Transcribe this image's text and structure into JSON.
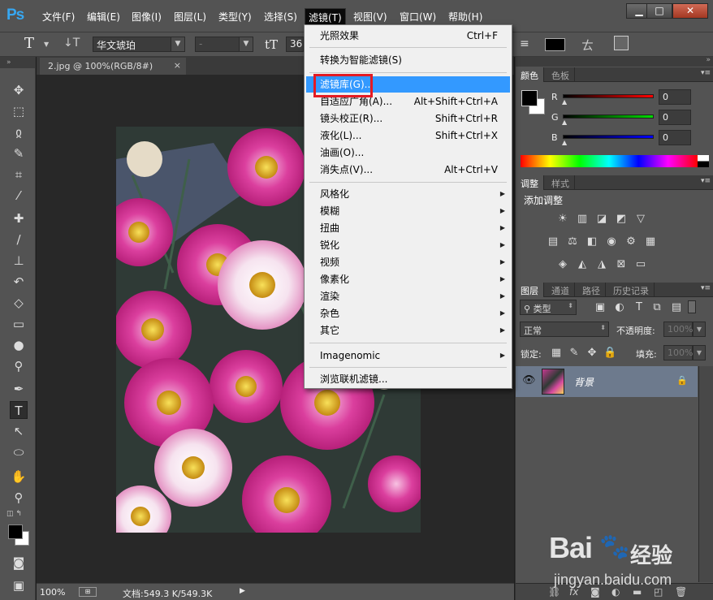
{
  "app": {
    "logo": "Ps"
  },
  "menubar": {
    "items": [
      "文件(F)",
      "编辑(E)",
      "图像(I)",
      "图层(L)",
      "类型(Y)",
      "选择(S)",
      "滤镜(T)",
      "视图(V)",
      "窗口(W)",
      "帮助(H)"
    ],
    "active_index": 6
  },
  "window_controls": {
    "minimize": "▁",
    "maximize": "□",
    "close": "✕"
  },
  "options": {
    "font_family": "华文琥珀",
    "font_style": "-",
    "font_size_partial": "36",
    "text_color": "#000000"
  },
  "document": {
    "tab_title": "2.jpg @ 100%(RGB/8#)",
    "tab_close": "×"
  },
  "status": {
    "zoom": "100%",
    "doc_info": "文档:549.3 K/549.3K"
  },
  "filter_menu": {
    "groups": [
      [
        {
          "label": "光照效果",
          "shortcut": "Ctrl+F"
        }
      ],
      [
        {
          "label": "转换为智能滤镜(S)",
          "shortcut": ""
        }
      ],
      [
        {
          "label": "滤镜库(G)...",
          "shortcut": "",
          "highlighted": true
        },
        {
          "label": "自适应广角(A)...",
          "shortcut": "Alt+Shift+Ctrl+A"
        },
        {
          "label": "镜头校正(R)...",
          "shortcut": "Shift+Ctrl+R"
        },
        {
          "label": "液化(L)...",
          "shortcut": "Shift+Ctrl+X"
        },
        {
          "label": "油画(O)...",
          "shortcut": ""
        },
        {
          "label": "消失点(V)...",
          "shortcut": "Alt+Ctrl+V"
        }
      ],
      [
        {
          "label": "风格化",
          "submenu": true
        },
        {
          "label": "模糊",
          "submenu": true
        },
        {
          "label": "扭曲",
          "submenu": true
        },
        {
          "label": "锐化",
          "submenu": true
        },
        {
          "label": "视频",
          "submenu": true
        },
        {
          "label": "像素化",
          "submenu": true
        },
        {
          "label": "渲染",
          "submenu": true
        },
        {
          "label": "杂色",
          "submenu": true
        },
        {
          "label": "其它",
          "submenu": true
        }
      ],
      [
        {
          "label": "Imagenomic",
          "submenu": true
        }
      ],
      [
        {
          "label": "浏览联机滤镜...",
          "shortcut": ""
        }
      ]
    ]
  },
  "color_panel": {
    "tabs": [
      "颜色",
      "色板"
    ],
    "channels": [
      {
        "label": "R",
        "value": "0",
        "color": "#ff0000"
      },
      {
        "label": "G",
        "value": "0",
        "color": "#00d000"
      },
      {
        "label": "B",
        "value": "0",
        "color": "#0000ff"
      }
    ],
    "foreground": "#000000",
    "background": "#ffffff"
  },
  "adjust_panel": {
    "tabs": [
      "调整",
      "样式"
    ],
    "title": "添加调整"
  },
  "layers_panel": {
    "tabs": [
      "图层",
      "通道",
      "路径",
      "历史记录"
    ],
    "filter_kind": "类型",
    "blend_mode": "正常",
    "opacity_label": "不透明度:",
    "opacity_value": "100%",
    "lock_label": "锁定:",
    "fill_label": "填充:",
    "fill_value": "100%",
    "layer_name": "背景"
  },
  "watermark": {
    "brand": "Bai",
    "brand2": "经验",
    "url": "jingyan.baidu.com"
  }
}
